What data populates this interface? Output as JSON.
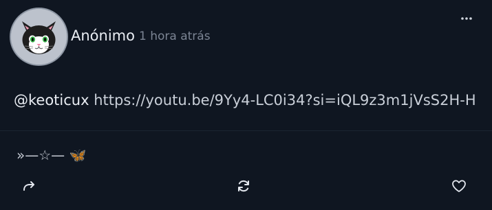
{
  "post": {
    "author": "Anónimo",
    "time": "1 hora atrás",
    "mention": "@keoticux",
    "link": "https://youtu.be/9Yy4-LC0i34?si=iQL9z3m1jVsS2H-H",
    "decoration": "»—☆— 🦋"
  },
  "icons": {
    "avatar": "cat-avatar",
    "more": "more-vertical-icon",
    "share": "share-icon",
    "repost": "refresh-icon",
    "like": "heart-icon"
  },
  "colors": {
    "background": "#0f1621",
    "text": "#dfe3ea",
    "muted": "#7c8594",
    "avatar_bg": "#bcc2cc"
  }
}
